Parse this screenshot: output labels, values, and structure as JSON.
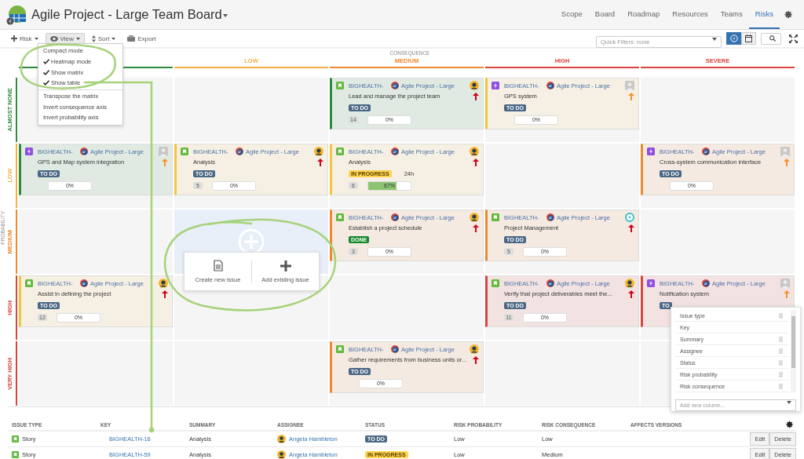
{
  "header": {
    "title": "Agile Project - Large Team Board",
    "tabs": [
      {
        "label": "Scope",
        "selected": false
      },
      {
        "label": "Board",
        "selected": false
      },
      {
        "label": "Roadmap",
        "selected": false
      },
      {
        "label": "Resources",
        "selected": false
      },
      {
        "label": "Teams",
        "selected": false
      },
      {
        "label": "Risks",
        "selected": true
      }
    ]
  },
  "toolbar": {
    "buttons": [
      {
        "label": "Risk",
        "kind": "plus",
        "dropdown": true,
        "selected": false
      },
      {
        "label": "View",
        "kind": "eye",
        "dropdown": true,
        "selected": true
      },
      {
        "label": "Sort",
        "kind": "sort",
        "dropdown": true,
        "selected": false
      },
      {
        "label": "Export",
        "kind": "export",
        "dropdown": false,
        "selected": false
      }
    ],
    "quick_filter": {
      "placeholder": "Quick Filters: none"
    },
    "toggles": [
      {
        "kind": "compass",
        "selected": true
      },
      {
        "kind": "calendar",
        "selected": false
      }
    ]
  },
  "view_menu": {
    "sections": [
      {
        "items": [
          {
            "label": "Compact mode",
            "checked": false
          },
          {
            "label": "Heatmap mode",
            "checked": true
          },
          {
            "label": "Show matrix",
            "checked": true
          },
          {
            "label": "Show table",
            "checked": true
          }
        ]
      },
      {
        "items": [
          {
            "label": "Transpose the matrix",
            "checked": false
          },
          {
            "label": "Invert consequence axis",
            "checked": false
          },
          {
            "label": "Invert probability axis",
            "checked": false
          }
        ]
      }
    ]
  },
  "matrix": {
    "x_axis": "CONSEQUENCE",
    "y_axis": "PROBABILITY",
    "columns": [
      {
        "color": "#2e8b3c"
      },
      {
        "label": "LOW",
        "color": "#f5b041"
      },
      {
        "label": "MEDIUM",
        "color": "#f0882e"
      },
      {
        "label": "HIGH",
        "color": "#d9443c"
      },
      {
        "label": "SEVERE",
        "color": "#d9443c"
      }
    ],
    "rows": [
      {
        "label": "ALMOST NONE",
        "color": "#2e8b3c",
        "cells": [
          {
            "kind": "empty"
          },
          {
            "kind": "empty"
          },
          {
            "kind": "card",
            "card": {
              "issue_type": {
                "kind": "story"
              },
              "key": "BIGHEALTH-",
              "project": "Agile Project - Large",
              "assignee": {
                "kind": "person"
              },
              "summary": "Lead and manage the project team",
              "priority": {
                "kind": "high"
              },
              "status": {
                "label": "TO DO",
                "kind": "todo"
              },
              "count": "14",
              "progress": {
                "level": 0,
                "label": "0%"
              },
              "color": "#2e8b3c"
            }
          },
          {
            "kind": "card",
            "card": {
              "issue_type": {
                "kind": "epic"
              },
              "key": "BIGHEALTH-",
              "project": "Agile Project - Large",
              "assignee": {
                "kind": "blank"
              },
              "summary": "GPS system",
              "priority": {
                "kind": "medium"
              },
              "status": {
                "label": "TO DO",
                "kind": "todo"
              },
              "progress": {
                "level": 0,
                "label": "0%"
              },
              "color": "#f5c342"
            }
          },
          {
            "kind": "empty"
          }
        ]
      },
      {
        "label": "LOW",
        "color": "#f5b041",
        "cells": [
          {
            "kind": "card",
            "card": {
              "issue_type": {
                "kind": "epic"
              },
              "key": "BIGHEALTH-",
              "project": "Agile Project - Large",
              "assignee": {
                "kind": "blank"
              },
              "summary": "GPS and Map system integration",
              "priority": {
                "kind": "medium"
              },
              "status": {
                "label": "TO DO",
                "kind": "todo"
              },
              "progress": {
                "level": 0,
                "label": "0%"
              },
              "color": "#2e8b3c"
            }
          },
          {
            "kind": "card",
            "card": {
              "issue_type": {
                "kind": "story"
              },
              "key": "BIGHEALTH-",
              "project": "Agile Project - Large",
              "assignee": {
                "kind": "person"
              },
              "summary": "Analysis",
              "priority": {
                "kind": "high"
              },
              "status": {
                "label": "TO DO",
                "kind": "todo"
              },
              "count": "5",
              "progress": {
                "level": 0,
                "label": "0%"
              },
              "color": "#f5c342"
            }
          },
          {
            "kind": "card",
            "card": {
              "issue_type": {
                "kind": "story"
              },
              "key": "BIGHEALTH-",
              "project": "Agile Project - Large",
              "assignee": {
                "kind": "person"
              },
              "summary": "Analysis",
              "priority": {
                "kind": "high"
              },
              "status": {
                "label": "IN PROGRESS",
                "kind": "progress"
              },
              "estimate": "24h",
              "count": "6",
              "progress": {
                "level": 0.67,
                "label": "67%"
              },
              "color": "#f5c342"
            }
          },
          {
            "kind": "empty"
          },
          {
            "kind": "card",
            "card": {
              "issue_type": {
                "kind": "epic"
              },
              "key": "BIGHEALTH-",
              "project": "Agile Project - Large",
              "assignee": {
                "kind": "blank"
              },
              "summary": "Cross-system communication interface",
              "priority": {
                "kind": "medium"
              },
              "status": {
                "label": "TO DO",
                "kind": "todo"
              },
              "progress": {
                "level": 0,
                "label": "0%"
              },
              "color": "#f0882e"
            }
          }
        ]
      },
      {
        "label": "MEDIUM",
        "color": "#f0882e",
        "cells": [
          {
            "kind": "empty"
          },
          {
            "kind": "add"
          },
          {
            "kind": "card",
            "card": {
              "issue_type": {
                "kind": "story"
              },
              "key": "BIGHEALTH-",
              "project": "Agile Project - Large",
              "assignee": {
                "kind": "person"
              },
              "summary": "Establish a project schedule",
              "priority": {
                "kind": "high"
              },
              "status": {
                "label": "DONE",
                "kind": "done"
              },
              "count": "3",
              "progress": {
                "level": 0,
                "label": "0%"
              },
              "color": "#f0882e"
            }
          },
          {
            "kind": "card",
            "card": {
              "issue_type": {
                "kind": "story"
              },
              "key": "BIGHEALTH-",
              "project": "Agile Project - Large",
              "assignee": {
                "kind": "ring"
              },
              "summary": "Project Management",
              "priority": {
                "kind": "high"
              },
              "status": {
                "label": "TO DO",
                "kind": "todo"
              },
              "count": "5",
              "progress": {
                "level": 0,
                "label": "0%"
              },
              "color": "#f0882e"
            }
          },
          {
            "kind": "empty"
          }
        ]
      },
      {
        "label": "HIGH",
        "color": "#d9443c",
        "cells": [
          {
            "kind": "card",
            "card": {
              "issue_type": {
                "kind": "story"
              },
              "key": "BIGHEALTH-",
              "project": "Agile Project - Large",
              "assignee": {
                "kind": "person"
              },
              "summary": "Assist in defining the project",
              "priority": {
                "kind": "high"
              },
              "status": {
                "label": "TO DO",
                "kind": "todo"
              },
              "count": "12",
              "progress": {
                "level": 0,
                "label": "0%"
              },
              "color": "#f5c342"
            }
          },
          {
            "kind": "empty"
          },
          {
            "kind": "empty"
          },
          {
            "kind": "card",
            "card": {
              "issue_type": {
                "kind": "story"
              },
              "key": "BIGHEALTH-",
              "project": "Agile Project - Large",
              "assignee": {
                "kind": "person"
              },
              "summary": "Verify  that  project  deliverables  meet  the...",
              "priority": {
                "kind": "high"
              },
              "status": {
                "label": "TO DO",
                "kind": "todo"
              },
              "count": "11",
              "progress": {
                "level": 0,
                "label": "0%"
              },
              "color": "#d9443c"
            }
          },
          {
            "kind": "card",
            "card": {
              "issue_type": {
                "kind": "epic"
              },
              "key": "BIGHEALTH-",
              "project": "Agile Project - Large",
              "assignee": {
                "kind": "blank"
              },
              "summary": "Notification system",
              "priority": {
                "kind": "medium"
              },
              "status": {
                "label": "TO",
                "kind": "todo"
              },
              "color": "#d9443c"
            }
          }
        ]
      },
      {
        "label": "VERY HIGH",
        "color": "#d9443c",
        "cells": [
          {
            "kind": "empty"
          },
          {
            "kind": "empty"
          },
          {
            "kind": "card",
            "card": {
              "issue_type": {
                "kind": "story"
              },
              "key": "BIGHEALTH-",
              "project": "Agile Project - Large",
              "assignee": {
                "kind": "person"
              },
              "summary": "Gather requirements from business units or...",
              "priority": {
                "kind": "high"
              },
              "status": {
                "label": "TO DO",
                "kind": "todo"
              },
              "progress": {
                "level": 0,
                "label": "0%"
              },
              "color": "#f0882e"
            }
          },
          {
            "kind": "empty"
          },
          {
            "kind": "empty"
          }
        ]
      }
    ]
  },
  "add_popover": {
    "create_label": "Create new issue",
    "add_label": "Add existing issue"
  },
  "column_chooser": {
    "items": [
      {
        "label": "Issue type",
        "removable": true
      },
      {
        "label": "Key",
        "removable": false
      },
      {
        "label": "Summary",
        "removable": true
      },
      {
        "label": "Assignee",
        "removable": true
      },
      {
        "label": "Status",
        "removable": true
      },
      {
        "label": "Risk probability",
        "removable": true
      },
      {
        "label": "Risk consequence",
        "removable": true
      }
    ],
    "placeholder": "Add new column..."
  },
  "table": {
    "columns": [
      "ISSUE TYPE",
      "KEY",
      "SUMMARY",
      "ASSIGNEE",
      "STATUS",
      "RISK PROBABILITY",
      "RISK CONSEQUENCE",
      "AFFECTS VERSIONS"
    ],
    "rows": [
      {
        "issue_type": "Story",
        "key": "BIGHEALTH-16",
        "summary": "Analysis",
        "assignee": "Angela Hambleton",
        "status": {
          "label": "TO DO",
          "kind": "todo"
        },
        "probability": "Low",
        "consequence": "Low",
        "actions": [
          "Edit",
          "Delete"
        ]
      },
      {
        "issue_type": "Story",
        "key": "BIGHEALTH-59",
        "summary": "Analysis",
        "assignee": "Angela Hambleton",
        "status": {
          "label": "IN PROGRESS",
          "kind": "progress"
        },
        "probability": "Low",
        "consequence": "Medium",
        "actions": [
          "Edit",
          "Delete"
        ]
      }
    ]
  }
}
